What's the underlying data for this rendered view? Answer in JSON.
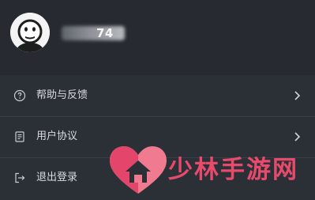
{
  "profile": {
    "username_visible": "74"
  },
  "menu": {
    "items": [
      {
        "label": "帮助与反馈",
        "icon": "help-circle-icon"
      },
      {
        "label": "用户协议",
        "icon": "document-icon"
      },
      {
        "label": "退出登录",
        "icon": "logout-icon"
      }
    ]
  },
  "watermark": {
    "text": "少林手游网"
  },
  "colors": {
    "header_bg": "#272b31",
    "menu_bg": "#2b3037",
    "text": "#d9dbde",
    "watermark": "#e84a6c"
  }
}
